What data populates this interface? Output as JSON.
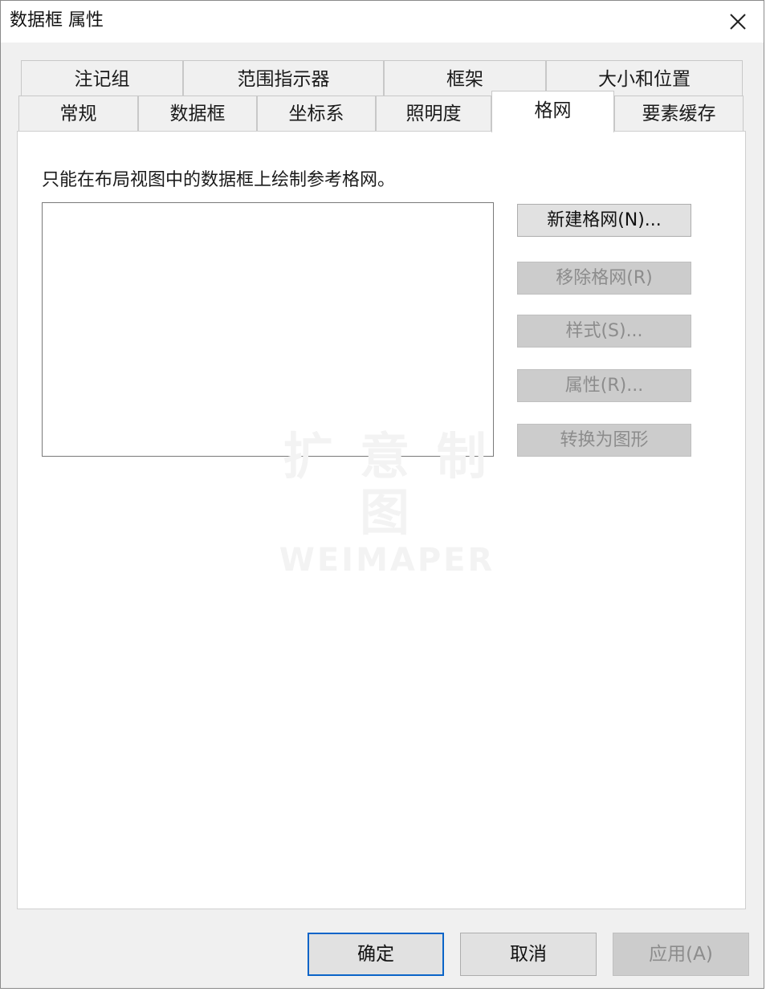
{
  "window": {
    "title": "数据框 属性"
  },
  "tabs": {
    "row1": [
      {
        "label": "注记组"
      },
      {
        "label": "范围指示器"
      },
      {
        "label": "框架"
      },
      {
        "label": "大小和位置"
      }
    ],
    "row2": [
      {
        "label": "常规"
      },
      {
        "label": "数据框"
      },
      {
        "label": "坐标系"
      },
      {
        "label": "照明度"
      },
      {
        "label": "格网",
        "active": true
      },
      {
        "label": "要素缓存"
      }
    ]
  },
  "grid_panel": {
    "hint": "只能在布局视图中的数据框上绘制参考格网。",
    "buttons": {
      "new_grid": "新建格网(N)...",
      "remove_grid": "移除格网(R)",
      "style": "样式(S)...",
      "properties": "属性(R)...",
      "convert_to_graphics": "转换为图形"
    }
  },
  "watermark": {
    "main": "扩 意 制 图",
    "sub": "WEIMAPER"
  },
  "footer": {
    "ok": "确定",
    "cancel": "取消",
    "apply": "应用(A)"
  }
}
